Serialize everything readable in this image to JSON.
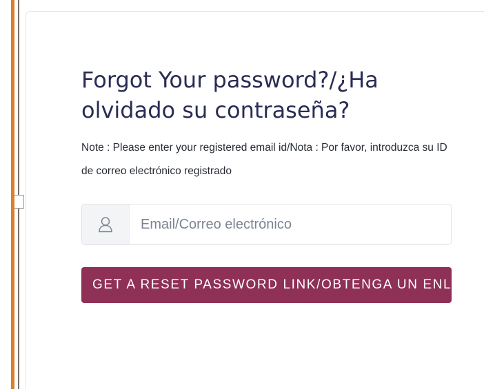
{
  "form": {
    "title": "Forgot Your password?/¿Ha olvidado su contraseña?",
    "note": "Note : Please enter your registered email id/Nota : Por favor, introduzca su ID de correo electrónico registrado",
    "email_input": {
      "icon": "user-icon",
      "placeholder": "Email/Correo electrónico",
      "value": ""
    },
    "submit_label": "GET A RESET PASSWORD LINK/OBTENGA UN ENLACE PARA RESTABLECER LA CONTRASEÑA"
  },
  "colors": {
    "title": "#2a2c55",
    "button_background": "#8f3056",
    "button_text": "#ffffff",
    "accent_bar": "#d9802f"
  }
}
